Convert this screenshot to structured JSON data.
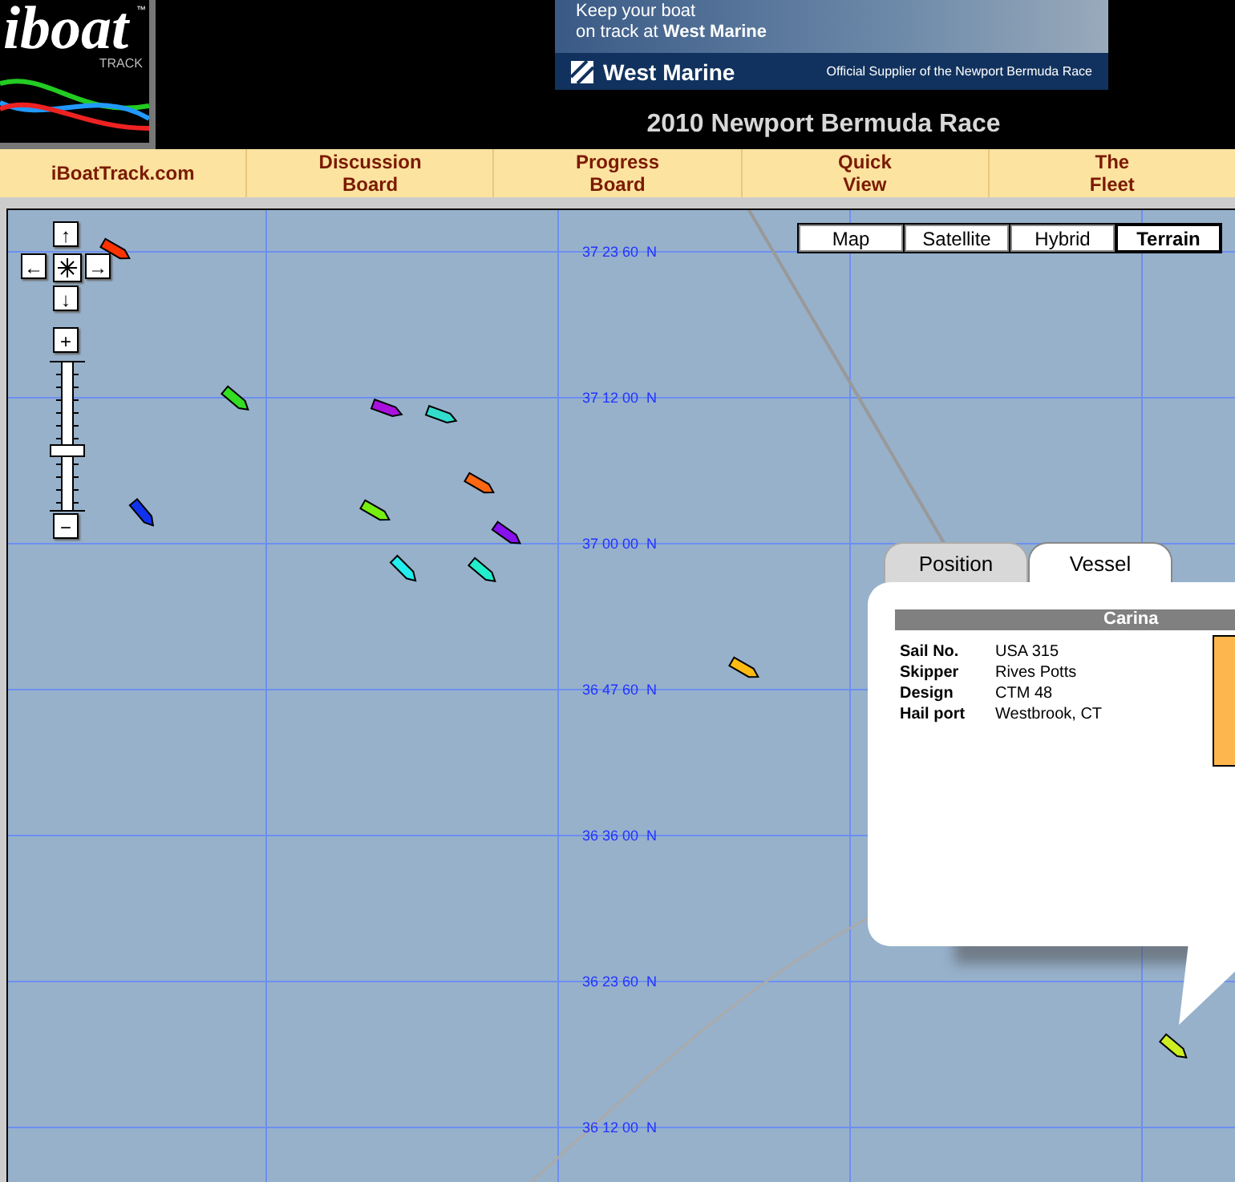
{
  "logo": {
    "word": "iboat",
    "tm": "™",
    "sub": "TRACK"
  },
  "ad": {
    "line1": "Keep your boat",
    "line2": "on track at **West Marine**",
    "brand": "West Marine",
    "tagline": "Official Supplier of the Newport Bermuda Race"
  },
  "title": "2010 Newport Bermuda Race",
  "nav": [
    {
      "label": "iBoatTrack.com"
    },
    {
      "label": "Discussion\nBoard"
    },
    {
      "label": "Progress\nBoard"
    },
    {
      "label": "Quick\nView"
    },
    {
      "label": "The\nFleet"
    }
  ],
  "map": {
    "pan": [
      "↑",
      "←",
      "↓",
      "→"
    ],
    "zoom_in": "+",
    "zoom_out": "−",
    "zoom": {
      "level": 0.4
    },
    "types": [
      {
        "label": "Map",
        "selected": false
      },
      {
        "label": "Satellite",
        "selected": false
      },
      {
        "label": "Hybrid",
        "selected": false
      },
      {
        "label": "Terrain",
        "selected": true
      }
    ],
    "latitudes": [
      "37 23 60  N",
      "37 12 00  N",
      "37 00 00  N",
      "36 47 60  N",
      "36 36 00  N",
      "36 23 60  N",
      "36 12 00  N"
    ],
    "boats": [
      {
        "color": "#ff3300"
      },
      {
        "color": "#33dd22"
      },
      {
        "color": "#aa11dd"
      },
      {
        "color": "#33ddcc"
      },
      {
        "color": "#ff6611"
      },
      {
        "color": "#1133ee"
      },
      {
        "color": "#77ee11"
      },
      {
        "color": "#8811ee"
      },
      {
        "color": "#22eeee"
      },
      {
        "color": "#22eecc"
      },
      {
        "color": "#ffbb11"
      },
      {
        "color": "#ccee22"
      }
    ]
  },
  "popup": {
    "tabs": [
      {
        "label": "Position",
        "selected": false
      },
      {
        "label": "Vessel",
        "selected": true
      }
    ],
    "vessel": "Carina",
    "details": [
      {
        "label": "Sail No.",
        "value": "USA 315"
      },
      {
        "label": "Skipper",
        "value": "Rives Potts"
      },
      {
        "label": "Design",
        "value": "CTM 48"
      },
      {
        "label": "Hail port",
        "value": "Westbrook, CT"
      }
    ]
  }
}
